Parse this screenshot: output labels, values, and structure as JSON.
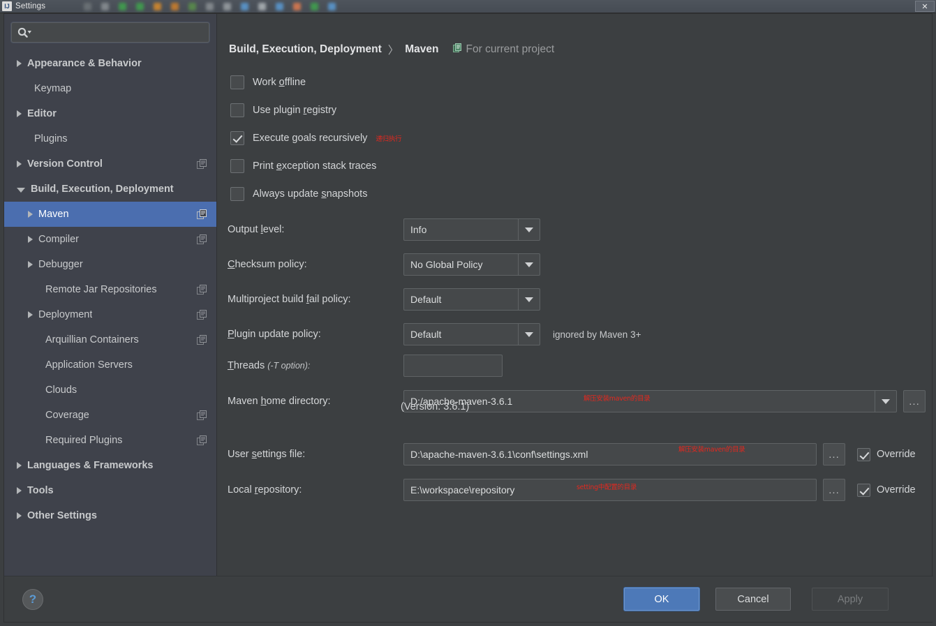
{
  "window": {
    "title": "Settings",
    "app_icon": "intellij-idea-icon",
    "close_label": "✕"
  },
  "sidebar": {
    "search": {
      "value": "",
      "placeholder": "",
      "icon": "search-icon"
    },
    "items": [
      {
        "label": "Appearance & Behavior",
        "depth": 0,
        "arrow": "collapsed",
        "project_icon": false,
        "selected": false
      },
      {
        "label": "Keymap",
        "depth": 0,
        "arrow": "none",
        "project_icon": false,
        "selected": false
      },
      {
        "label": "Editor",
        "depth": 0,
        "arrow": "collapsed",
        "project_icon": false,
        "selected": false
      },
      {
        "label": "Plugins",
        "depth": 0,
        "arrow": "none",
        "project_icon": false,
        "selected": false
      },
      {
        "label": "Version Control",
        "depth": 0,
        "arrow": "collapsed",
        "project_icon": true,
        "selected": false
      },
      {
        "label": "Build, Execution, Deployment",
        "depth": 0,
        "arrow": "expanded",
        "project_icon": false,
        "selected": false
      },
      {
        "label": "Maven",
        "depth": 1,
        "arrow": "collapsed",
        "project_icon": true,
        "selected": true
      },
      {
        "label": "Compiler",
        "depth": 1,
        "arrow": "collapsed",
        "project_icon": true,
        "selected": false
      },
      {
        "label": "Debugger",
        "depth": 1,
        "arrow": "collapsed",
        "project_icon": false,
        "selected": false
      },
      {
        "label": "Remote Jar Repositories",
        "depth": 1,
        "arrow": "none",
        "project_icon": true,
        "selected": false
      },
      {
        "label": "Deployment",
        "depth": 1,
        "arrow": "collapsed",
        "project_icon": true,
        "selected": false
      },
      {
        "label": "Arquillian Containers",
        "depth": 1,
        "arrow": "none",
        "project_icon": true,
        "selected": false
      },
      {
        "label": "Application Servers",
        "depth": 1,
        "arrow": "none",
        "project_icon": false,
        "selected": false
      },
      {
        "label": "Clouds",
        "depth": 1,
        "arrow": "none",
        "project_icon": false,
        "selected": false
      },
      {
        "label": "Coverage",
        "depth": 1,
        "arrow": "none",
        "project_icon": true,
        "selected": false
      },
      {
        "label": "Required Plugins",
        "depth": 1,
        "arrow": "none",
        "project_icon": true,
        "selected": false
      },
      {
        "label": "Languages & Frameworks",
        "depth": 0,
        "arrow": "collapsed",
        "project_icon": false,
        "selected": false
      },
      {
        "label": "Tools",
        "depth": 0,
        "arrow": "collapsed",
        "project_icon": false,
        "selected": false
      },
      {
        "label": "Other Settings",
        "depth": 0,
        "arrow": "collapsed",
        "project_icon": false,
        "selected": false
      }
    ]
  },
  "breadcrumb": {
    "parent": "Build, Execution, Deployment",
    "separator": "〉",
    "current": "Maven",
    "project_scope": "For current project",
    "project_scope_icon": "project-settings-icon"
  },
  "checkboxes": [
    {
      "label": "Work offline",
      "mnemonic": "o",
      "checked": false,
      "annotation": ""
    },
    {
      "label": "Use plugin registry",
      "mnemonic": "r",
      "checked": false,
      "annotation": ""
    },
    {
      "label": "Execute goals recursively",
      "mnemonic": "g",
      "checked": true,
      "annotation": "递归执行"
    },
    {
      "label": "Print exception stack traces",
      "mnemonic": "e",
      "checked": false,
      "annotation": ""
    },
    {
      "label": "Always update snapshots",
      "mnemonic": "s",
      "checked": false,
      "annotation": ""
    }
  ],
  "fields": {
    "output_level": {
      "label": "Output level:",
      "value": "Info",
      "type": "combo"
    },
    "checksum_policy": {
      "label": "Checksum policy:",
      "value": "No Global Policy",
      "type": "combo"
    },
    "multiproject": {
      "label": "Multiproject build fail policy:",
      "value": "Default",
      "type": "combo"
    },
    "plugin_update": {
      "label": "Plugin update policy:",
      "value": "Default",
      "type": "combo",
      "hint": "ignored by Maven 3+"
    },
    "threads": {
      "label": "Threads ",
      "label_italic": "(-T option):",
      "value": "",
      "type": "text"
    },
    "maven_home": {
      "label": "Maven home directory:",
      "value": "D:/apache-maven-3.6.1",
      "type": "combo-browse",
      "annotation": "解压安装maven的目录",
      "browse_label": "..."
    },
    "version_note": "(Version: 3.6.1)",
    "user_settings": {
      "label": "User settings file:",
      "value": "D:\\apache-maven-3.6.1\\conf\\settings.xml",
      "type": "text-browse",
      "annotation": "解压安装maven的目录",
      "browse_label": "...",
      "override_label": "Override",
      "override_checked": true
    },
    "local_repo": {
      "label": "Local repository:",
      "value": "E:\\workspace\\repository",
      "type": "text-browse",
      "annotation": "setting中配置的目录",
      "browse_label": "...",
      "override_label": "Override",
      "override_checked": true
    }
  },
  "footer": {
    "help_label": "?",
    "ok_label": "OK",
    "cancel_label": "Cancel",
    "apply_label": "Apply"
  },
  "colors": {
    "selection_blue": "#4b6eaf",
    "panel_bg": "#3c3f41",
    "sidebar_bg": "#3f424b",
    "annotation_red": "#e2281f",
    "ok_button": "#4d79b8"
  }
}
